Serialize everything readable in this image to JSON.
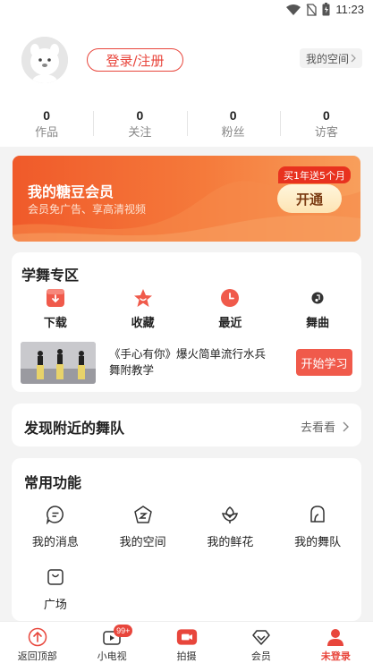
{
  "status": {
    "time": "11:23"
  },
  "profile": {
    "login_label": "登录/注册",
    "space_label": "我的空间"
  },
  "stats": [
    {
      "value": "0",
      "label": "作品"
    },
    {
      "value": "0",
      "label": "关注"
    },
    {
      "value": "0",
      "label": "粉丝"
    },
    {
      "value": "0",
      "label": "访客"
    }
  ],
  "vip": {
    "title": "我的糖豆会员",
    "subtitle": "会员免广告、享高清视频",
    "badge": "买1年送5个月",
    "button": "开通",
    "colors": {
      "start": "#f05a2a",
      "end": "#f89f5c"
    }
  },
  "dance": {
    "title": "学舞专区",
    "items": [
      {
        "label": "下载",
        "icon": "download-icon"
      },
      {
        "label": "收藏",
        "icon": "star-icon"
      },
      {
        "label": "最近",
        "icon": "clock-icon"
      },
      {
        "label": "舞曲",
        "icon": "music-note-icon"
      }
    ],
    "course": {
      "text": "《手心有你》爆火简单流行水兵舞附教学",
      "button": "开始学习"
    }
  },
  "nearby": {
    "title": "发现附近的舞队",
    "link": "去看看"
  },
  "functions": {
    "title": "常用功能",
    "items": [
      {
        "label": "我的消息",
        "icon": "message-icon"
      },
      {
        "label": "我的空间",
        "icon": "space-icon"
      },
      {
        "label": "我的鲜花",
        "icon": "flower-icon"
      },
      {
        "label": "我的舞队",
        "icon": "team-icon"
      },
      {
        "label": "广场",
        "icon": "shopping-bag-icon"
      }
    ]
  },
  "tabbar": {
    "items": [
      {
        "label": "返回顶部",
        "icon": "arrow-up-icon"
      },
      {
        "label": "小电视",
        "icon": "tv-icon",
        "badge": "99+"
      },
      {
        "label": "拍摄",
        "icon": "camera-icon"
      },
      {
        "label": "会员",
        "icon": "diamond-icon"
      },
      {
        "label": "未登录",
        "icon": "user-icon",
        "active": true
      }
    ]
  },
  "accent_color": "#e8463c"
}
